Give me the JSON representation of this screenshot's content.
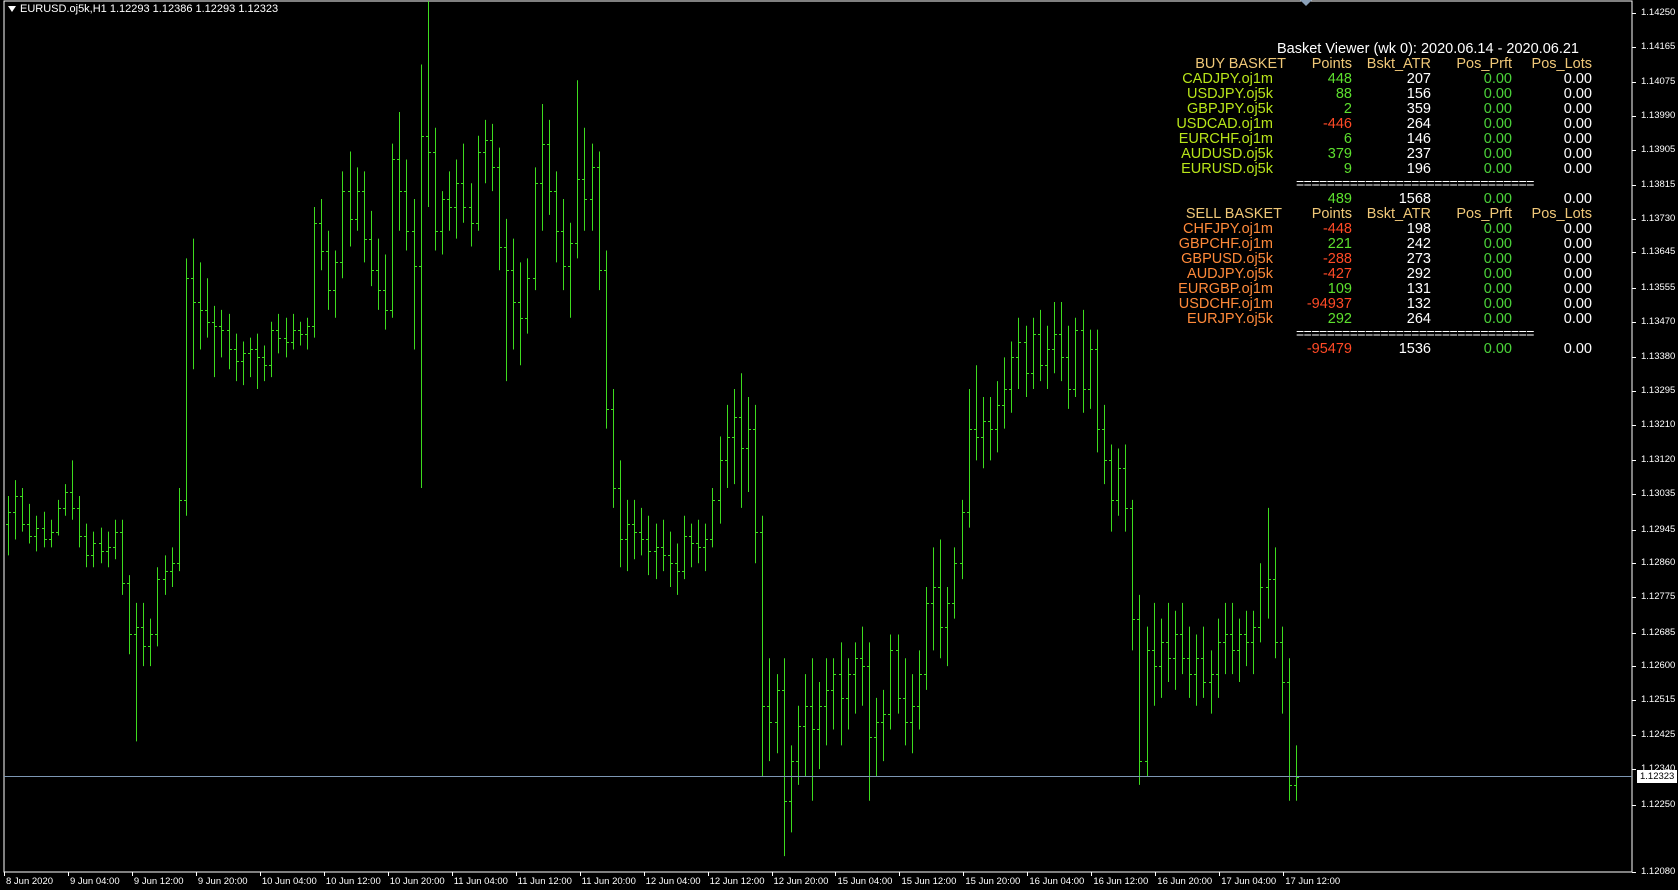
{
  "window": {
    "header": "EURUSD.oj5k,H1  1.12293 1.12386 1.12293 1.12323"
  },
  "colors": {
    "background": "#000000",
    "candle": "#3ddc1e",
    "price_line": "#7d97b3",
    "frame": "#ffffff"
  },
  "chart_data": {
    "type": "bar",
    "symbol": "EURUSD.oj5k",
    "timeframe": "H1",
    "ylim": [
      1.1208,
      1.1425
    ],
    "y_ticks": [
      "1.14250",
      "1.14165",
      "1.14075",
      "1.13990",
      "1.13905",
      "1.13815",
      "1.13730",
      "1.13645",
      "1.13555",
      "1.13470",
      "1.13380",
      "1.13295",
      "1.13210",
      "1.13120",
      "1.13035",
      "1.12945",
      "1.12860",
      "1.12775",
      "1.12685",
      "1.12600",
      "1.12515",
      "1.12425",
      "1.12340",
      "1.12250",
      "1.12080"
    ],
    "x_ticks": [
      "8 Jun 2020",
      "9 Jun 04:00",
      "9 Jun 12:00",
      "9 Jun 20:00",
      "10 Jun 04:00",
      "10 Jun 12:00",
      "10 Jun 20:00",
      "11 Jun 04:00",
      "11 Jun 12:00",
      "11 Jun 20:00",
      "12 Jun 04:00",
      "12 Jun 12:00",
      "12 Jun 20:00",
      "15 Jun 04:00",
      "15 Jun 12:00",
      "15 Jun 20:00",
      "16 Jun 04:00",
      "16 Jun 12:00",
      "16 Jun 20:00",
      "17 Jun 04:00",
      "17 Jun 12:00"
    ],
    "current_price": "1.12323",
    "current_price_value": 1.12323,
    "bars": [
      [
        1.1296,
        1.1303,
        1.1288,
        1.1299
      ],
      [
        1.1299,
        1.1307,
        1.1292,
        1.1303
      ],
      [
        1.1303,
        1.1305,
        1.1294,
        1.1296
      ],
      [
        1.1296,
        1.1301,
        1.1291,
        1.1293
      ],
      [
        1.1293,
        1.1298,
        1.1289,
        1.1295
      ],
      [
        1.1295,
        1.1299,
        1.129,
        1.1292
      ],
      [
        1.1292,
        1.1297,
        1.129,
        1.1294
      ],
      [
        1.1294,
        1.1302,
        1.1293,
        1.13
      ],
      [
        1.13,
        1.1306,
        1.1298,
        1.1304
      ],
      [
        1.1304,
        1.1312,
        1.1297,
        1.13
      ],
      [
        1.13,
        1.1303,
        1.129,
        1.1293
      ],
      [
        1.1293,
        1.1296,
        1.1285,
        1.1288
      ],
      [
        1.1288,
        1.1294,
        1.1285,
        1.1291
      ],
      [
        1.1291,
        1.1295,
        1.1286,
        1.1289
      ],
      [
        1.1289,
        1.1294,
        1.1285,
        1.129
      ],
      [
        1.129,
        1.1297,
        1.1287,
        1.1294
      ],
      [
        1.1294,
        1.1297,
        1.1278,
        1.1281
      ],
      [
        1.1281,
        1.1283,
        1.1263,
        1.1268
      ],
      [
        1.1268,
        1.1276,
        1.1241,
        1.127
      ],
      [
        1.127,
        1.1276,
        1.126,
        1.1265
      ],
      [
        1.1265,
        1.1272,
        1.126,
        1.1268
      ],
      [
        1.1268,
        1.1285,
        1.1265,
        1.1282
      ],
      [
        1.1282,
        1.1288,
        1.1278,
        1.1284
      ],
      [
        1.1284,
        1.129,
        1.128,
        1.1286
      ],
      [
        1.1286,
        1.1305,
        1.1284,
        1.1302
      ],
      [
        1.1302,
        1.1363,
        1.1298,
        1.1358
      ],
      [
        1.1358,
        1.1368,
        1.1335,
        1.1352
      ],
      [
        1.1352,
        1.1362,
        1.134,
        1.135
      ],
      [
        1.135,
        1.1358,
        1.1343,
        1.1347
      ],
      [
        1.1347,
        1.1351,
        1.1333,
        1.1346
      ],
      [
        1.1346,
        1.135,
        1.1338,
        1.1345
      ],
      [
        1.1345,
        1.1349,
        1.1335,
        1.134
      ],
      [
        1.134,
        1.1344,
        1.1332,
        1.1337
      ],
      [
        1.1337,
        1.1342,
        1.1331,
        1.1339
      ],
      [
        1.1339,
        1.1343,
        1.1333,
        1.134
      ],
      [
        1.134,
        1.1344,
        1.133,
        1.1338
      ],
      [
        1.1338,
        1.1341,
        1.1332,
        1.1336
      ],
      [
        1.1336,
        1.1347,
        1.1333,
        1.1345
      ],
      [
        1.1345,
        1.1349,
        1.1339,
        1.1343
      ],
      [
        1.1343,
        1.1348,
        1.1338,
        1.1342
      ],
      [
        1.1342,
        1.1349,
        1.134,
        1.1345
      ],
      [
        1.1345,
        1.1347,
        1.1341,
        1.1344
      ],
      [
        1.1344,
        1.1348,
        1.134,
        1.1346
      ],
      [
        1.1346,
        1.1376,
        1.1343,
        1.1372
      ],
      [
        1.1372,
        1.1378,
        1.136,
        1.1365
      ],
      [
        1.1365,
        1.137,
        1.135,
        1.1355
      ],
      [
        1.1355,
        1.1365,
        1.1348,
        1.1362
      ],
      [
        1.1362,
        1.1385,
        1.1358,
        1.138
      ],
      [
        1.138,
        1.139,
        1.1366,
        1.1373
      ],
      [
        1.1373,
        1.1386,
        1.137,
        1.138
      ],
      [
        1.138,
        1.1385,
        1.1362,
        1.1368
      ],
      [
        1.1368,
        1.1375,
        1.1356,
        1.136
      ],
      [
        1.136,
        1.1368,
        1.135,
        1.1355
      ],
      [
        1.1355,
        1.1364,
        1.1345,
        1.135
      ],
      [
        1.135,
        1.1392,
        1.1348,
        1.1388
      ],
      [
        1.1388,
        1.14,
        1.137,
        1.138
      ],
      [
        1.138,
        1.1388,
        1.1365,
        1.137
      ],
      [
        1.137,
        1.1378,
        1.134,
        1.1361
      ],
      [
        1.1361,
        1.1412,
        1.1305,
        1.1394
      ],
      [
        1.1394,
        1.1428,
        1.1376,
        1.139
      ],
      [
        1.139,
        1.1396,
        1.1365,
        1.137
      ],
      [
        1.137,
        1.138,
        1.1364,
        1.1378
      ],
      [
        1.1378,
        1.1385,
        1.137,
        1.1376
      ],
      [
        1.1376,
        1.1388,
        1.1368,
        1.1382
      ],
      [
        1.1382,
        1.1392,
        1.1372,
        1.1376
      ],
      [
        1.1376,
        1.1382,
        1.1366,
        1.1372
      ],
      [
        1.1372,
        1.1394,
        1.137,
        1.139
      ],
      [
        1.139,
        1.1398,
        1.1382,
        1.1393
      ],
      [
        1.1393,
        1.1397,
        1.138,
        1.1386
      ],
      [
        1.1386,
        1.1391,
        1.136,
        1.1366
      ],
      [
        1.1366,
        1.1373,
        1.1332,
        1.136
      ],
      [
        1.136,
        1.1368,
        1.134,
        1.1352
      ],
      [
        1.1352,
        1.1362,
        1.1336,
        1.1348
      ],
      [
        1.1348,
        1.1363,
        1.1344,
        1.1358
      ],
      [
        1.1358,
        1.1386,
        1.1355,
        1.1382
      ],
      [
        1.1382,
        1.1402,
        1.137,
        1.1392
      ],
      [
        1.1392,
        1.1398,
        1.1374,
        1.138
      ],
      [
        1.138,
        1.1385,
        1.1362,
        1.137
      ],
      [
        1.137,
        1.1378,
        1.1355,
        1.1361
      ],
      [
        1.1361,
        1.1372,
        1.1348,
        1.1367
      ],
      [
        1.1367,
        1.1408,
        1.1363,
        1.1383
      ],
      [
        1.1383,
        1.1396,
        1.137,
        1.1378
      ],
      [
        1.1378,
        1.1392,
        1.137,
        1.1386
      ],
      [
        1.1386,
        1.139,
        1.1355,
        1.136
      ],
      [
        1.136,
        1.1365,
        1.132,
        1.1325
      ],
      [
        1.1325,
        1.133,
        1.13,
        1.1305
      ],
      [
        1.1305,
        1.1312,
        1.1285,
        1.1292
      ],
      [
        1.1292,
        1.1302,
        1.1284,
        1.1296
      ],
      [
        1.1296,
        1.1302,
        1.1287,
        1.1294
      ],
      [
        1.1294,
        1.13,
        1.1288,
        1.1292
      ],
      [
        1.1292,
        1.1298,
        1.1283,
        1.1289
      ],
      [
        1.1289,
        1.1296,
        1.1282,
        1.129
      ],
      [
        1.129,
        1.1297,
        1.1284,
        1.1288
      ],
      [
        1.1288,
        1.1294,
        1.128,
        1.1286
      ],
      [
        1.1286,
        1.1291,
        1.1278,
        1.1284
      ],
      [
        1.1284,
        1.1298,
        1.1282,
        1.1293
      ],
      [
        1.1293,
        1.1296,
        1.1285,
        1.1291
      ],
      [
        1.1291,
        1.1297,
        1.1286,
        1.129
      ],
      [
        1.129,
        1.1296,
        1.1284,
        1.1292
      ],
      [
        1.1292,
        1.1305,
        1.129,
        1.1302
      ],
      [
        1.1302,
        1.1318,
        1.1296,
        1.1312
      ],
      [
        1.1312,
        1.1326,
        1.1305,
        1.1318
      ],
      [
        1.1318,
        1.133,
        1.1306,
        1.1323
      ],
      [
        1.1323,
        1.1334,
        1.13,
        1.1315
      ],
      [
        1.1315,
        1.1328,
        1.1304,
        1.132
      ],
      [
        1.132,
        1.1326,
        1.1286,
        1.1294
      ],
      [
        1.1294,
        1.1298,
        1.1232,
        1.125
      ],
      [
        1.125,
        1.1262,
        1.1236,
        1.1246
      ],
      [
        1.1246,
        1.1258,
        1.1238,
        1.1254
      ],
      [
        1.1254,
        1.1262,
        1.1212,
        1.1226
      ],
      [
        1.1226,
        1.124,
        1.1218,
        1.1236
      ],
      [
        1.1236,
        1.125,
        1.123,
        1.1245
      ],
      [
        1.1245,
        1.1258,
        1.1232,
        1.125
      ],
      [
        1.125,
        1.1262,
        1.1226,
        1.1244
      ],
      [
        1.1244,
        1.1256,
        1.1234,
        1.125
      ],
      [
        1.125,
        1.1262,
        1.124,
        1.1254
      ],
      [
        1.1254,
        1.1262,
        1.1244,
        1.1258
      ],
      [
        1.1258,
        1.1266,
        1.124,
        1.1252
      ],
      [
        1.1252,
        1.1262,
        1.1244,
        1.1258
      ],
      [
        1.1258,
        1.1266,
        1.1248,
        1.1262
      ],
      [
        1.1262,
        1.127,
        1.125,
        1.126
      ],
      [
        1.126,
        1.1266,
        1.1226,
        1.1242
      ],
      [
        1.1242,
        1.1252,
        1.1232,
        1.1246
      ],
      [
        1.1246,
        1.1254,
        1.1236,
        1.1248
      ],
      [
        1.1248,
        1.1268,
        1.1244,
        1.1264
      ],
      [
        1.1264,
        1.1268,
        1.1248,
        1.1252
      ],
      [
        1.1252,
        1.1262,
        1.124,
        1.1246
      ],
      [
        1.1246,
        1.1258,
        1.1238,
        1.125
      ],
      [
        1.125,
        1.1264,
        1.1244,
        1.1258
      ],
      [
        1.1258,
        1.128,
        1.1254,
        1.1276
      ],
      [
        1.1276,
        1.129,
        1.1264,
        1.128
      ],
      [
        1.128,
        1.1292,
        1.1262,
        1.127
      ],
      [
        1.127,
        1.128,
        1.126,
        1.1276
      ],
      [
        1.1276,
        1.129,
        1.1272,
        1.1286
      ],
      [
        1.1286,
        1.1302,
        1.1282,
        1.1299
      ],
      [
        1.1299,
        1.133,
        1.1295,
        1.132
      ],
      [
        1.132,
        1.1336,
        1.1312,
        1.1318
      ],
      [
        1.1318,
        1.1328,
        1.131,
        1.1322
      ],
      [
        1.1322,
        1.1328,
        1.1312,
        1.132
      ],
      [
        1.132,
        1.1332,
        1.1314,
        1.1326
      ],
      [
        1.1326,
        1.1338,
        1.132,
        1.133
      ],
      [
        1.133,
        1.1342,
        1.1324,
        1.1338
      ],
      [
        1.1338,
        1.1348,
        1.133,
        1.1342
      ],
      [
        1.1342,
        1.1346,
        1.1328,
        1.1334
      ],
      [
        1.1334,
        1.1348,
        1.133,
        1.1344
      ],
      [
        1.1344,
        1.135,
        1.1332,
        1.1336
      ],
      [
        1.1336,
        1.1346,
        1.133,
        1.134
      ],
      [
        1.134,
        1.1352,
        1.1334,
        1.1344
      ],
      [
        1.1344,
        1.1352,
        1.1332,
        1.1338
      ],
      [
        1.1338,
        1.1346,
        1.1325,
        1.133
      ],
      [
        1.133,
        1.1348,
        1.1328,
        1.1345
      ],
      [
        1.1345,
        1.135,
        1.1324,
        1.133
      ],
      [
        1.133,
        1.1345,
        1.1325,
        1.134
      ],
      [
        1.134,
        1.1345,
        1.1314,
        1.132
      ],
      [
        1.132,
        1.1326,
        1.1306,
        1.1312
      ],
      [
        1.1312,
        1.1316,
        1.1294,
        1.1302
      ],
      [
        1.1302,
        1.1315,
        1.1298,
        1.131
      ],
      [
        1.131,
        1.1316,
        1.1294,
        1.13
      ],
      [
        1.13,
        1.1302,
        1.1264,
        1.1272
      ],
      [
        1.1272,
        1.1278,
        1.123,
        1.1236
      ],
      [
        1.1236,
        1.127,
        1.1232,
        1.1264
      ],
      [
        1.1264,
        1.1276,
        1.125,
        1.126
      ],
      [
        1.126,
        1.1272,
        1.1252,
        1.1266
      ],
      [
        1.1266,
        1.1276,
        1.1256,
        1.1262
      ],
      [
        1.1262,
        1.1274,
        1.1254,
        1.1268
      ],
      [
        1.1268,
        1.1276,
        1.1258,
        1.1262
      ],
      [
        1.1262,
        1.127,
        1.1252,
        1.1258
      ],
      [
        1.1258,
        1.1268,
        1.125,
        1.1262
      ],
      [
        1.1262,
        1.127,
        1.1252,
        1.1256
      ],
      [
        1.1256,
        1.1264,
        1.1248,
        1.1258
      ],
      [
        1.1258,
        1.1272,
        1.1252,
        1.1266
      ],
      [
        1.1266,
        1.1276,
        1.1258,
        1.1268
      ],
      [
        1.1268,
        1.1276,
        1.1258,
        1.1264
      ],
      [
        1.1264,
        1.1272,
        1.1256,
        1.1268
      ],
      [
        1.1268,
        1.1274,
        1.126,
        1.1266
      ],
      [
        1.1266,
        1.1274,
        1.1258,
        1.127
      ],
      [
        1.127,
        1.1286,
        1.1266,
        1.128
      ],
      [
        1.128,
        1.13,
        1.1272,
        1.1282
      ],
      [
        1.1282,
        1.129,
        1.1262,
        1.1266
      ],
      [
        1.1266,
        1.127,
        1.1248,
        1.1256
      ],
      [
        1.1256,
        1.1262,
        1.1226,
        1.123
      ],
      [
        1.123,
        1.124,
        1.1226,
        1.1232
      ]
    ]
  },
  "basket": {
    "title": "Basket Viewer (wk 0): 2020.06.14  -   2020.06.21",
    "buy": {
      "header": "BUY BASKET",
      "cols": [
        "Points",
        "Bskt_ATR",
        "Pos_Prft",
        "Pos_Lots"
      ],
      "rows": [
        {
          "sym": "CADJPY.oj1m",
          "points": "448",
          "atr": "207",
          "prft": "0.00",
          "lots": "0.00",
          "neg": false
        },
        {
          "sym": "USDJPY.oj5k",
          "points": "88",
          "atr": "156",
          "prft": "0.00",
          "lots": "0.00",
          "neg": false
        },
        {
          "sym": "GBPJPY.oj5k",
          "points": "2",
          "atr": "359",
          "prft": "0.00",
          "lots": "0.00",
          "neg": false
        },
        {
          "sym": "USDCAD.oj1m",
          "points": "-446",
          "atr": "264",
          "prft": "0.00",
          "lots": "0.00",
          "neg": true
        },
        {
          "sym": "EURCHF.oj1m",
          "points": "6",
          "atr": "146",
          "prft": "0.00",
          "lots": "0.00",
          "neg": false
        },
        {
          "sym": "AUDUSD.oj5k",
          "points": "379",
          "atr": "237",
          "prft": "0.00",
          "lots": "0.00",
          "neg": false
        },
        {
          "sym": "EURUSD.oj5k",
          "points": "9",
          "atr": "196",
          "prft": "0.00",
          "lots": "0.00",
          "neg": false
        }
      ],
      "separator": "===============================",
      "total": {
        "points": "489",
        "atr": "1568",
        "prft": "0.00",
        "lots": "0.00",
        "neg": false
      }
    },
    "sell": {
      "header": "SELL BASKET",
      "cols": [
        "Points",
        "Bskt_ATR",
        "Pos_Prft",
        "Pos_Lots"
      ],
      "rows": [
        {
          "sym": "CHFJPY.oj1m",
          "points": "-448",
          "atr": "198",
          "prft": "0.00",
          "lots": "0.00",
          "neg": true
        },
        {
          "sym": "GBPCHF.oj1m",
          "points": "221",
          "atr": "242",
          "prft": "0.00",
          "lots": "0.00",
          "neg": false
        },
        {
          "sym": "GBPUSD.oj5k",
          "points": "-288",
          "atr": "273",
          "prft": "0.00",
          "lots": "0.00",
          "neg": true
        },
        {
          "sym": "AUDJPY.oj5k",
          "points": "-427",
          "atr": "292",
          "prft": "0.00",
          "lots": "0.00",
          "neg": true
        },
        {
          "sym": "EURGBP.oj1m",
          "points": "109",
          "atr": "131",
          "prft": "0.00",
          "lots": "0.00",
          "neg": false
        },
        {
          "sym": "USDCHF.oj1m",
          "points": "-94937",
          "atr": "132",
          "prft": "0.00",
          "lots": "0.00",
          "neg": true
        },
        {
          "sym": "EURJPY.oj5k",
          "points": "292",
          "atr": "264",
          "prft": "0.00",
          "lots": "0.00",
          "neg": false
        }
      ],
      "separator": "===============================",
      "total": {
        "points": "-95479",
        "atr": "1536",
        "prft": "0.00",
        "lots": "0.00",
        "neg": true
      }
    }
  }
}
